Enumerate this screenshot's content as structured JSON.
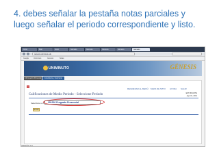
{
  "caption": {
    "line1": "4. debes señalar la pestaña notas parciales y",
    "line2": "luego señalar el periodo correspondiente y listo."
  },
  "browser": {
    "tabs": [
      {
        "label": "Inicio"
      },
      {
        "label": "Mail"
      },
      {
        "label": "Inicio"
      },
      {
        "label": "Génesis"
      },
      {
        "label": "Génesis"
      },
      {
        "label": "Génesis"
      },
      {
        "label": "Génesis"
      },
      {
        "label": "Génesis"
      }
    ],
    "address_text": "genesis.uniminuto.edu",
    "bookmarks": [
      {
        "label": "Google"
      },
      {
        "label": "Uniminuto"
      },
      {
        "label": "Génesis"
      },
      {
        "label": "Notas"
      }
    ]
  },
  "app": {
    "logo_text": "UNIMINUTO",
    "brand_text": "GÉNESIS",
    "subtabs": [
      {
        "label": "Información Personal"
      },
      {
        "label": "Estudiante y Aspirante"
      }
    ],
    "top_menu": [
      "REGRESAR AL MENÚ",
      "MAPA DE SITIO",
      "AYUDA",
      "SALIR"
    ],
    "page_title": "Calificaciones de Medio Periodo - Seleccione Periodo",
    "user_line1": "ESTUDIANTE",
    "user_line2": "Ago 31, 2011",
    "period_label": "Seleccione un Periodo:",
    "period_value": "201210 Pregrado Presencial",
    "submit_label": "Enviar",
    "footer": "VERSIÓN: 8.4"
  },
  "colors": {
    "caption": "#2e72b6",
    "banner": "#2a4d7c",
    "highlight": "#d43030"
  }
}
